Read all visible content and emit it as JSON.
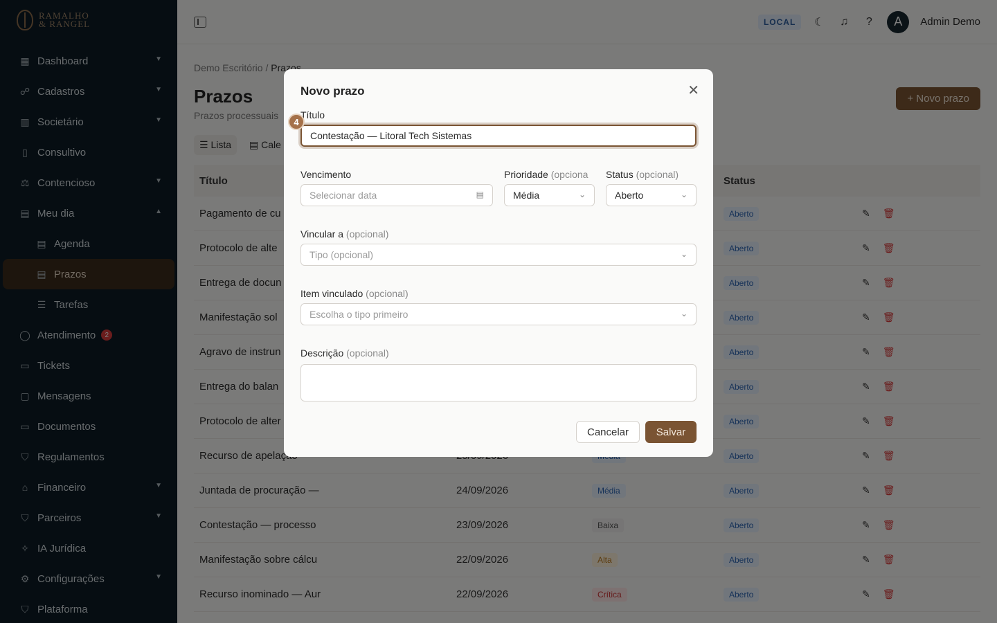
{
  "brand": {
    "name_line1": "RAMALHO",
    "name_line2": "& RANGEL"
  },
  "sidebar": {
    "items": [
      {
        "label": "Dashboard",
        "icon": "grid-icon"
      },
      {
        "label": "Cadastros",
        "icon": "people-icon"
      },
      {
        "label": "Societário",
        "icon": "building-icon"
      },
      {
        "label": "Consultivo",
        "icon": "book-icon"
      },
      {
        "label": "Contencioso",
        "icon": "scales-icon"
      },
      {
        "label": "Meu dia",
        "icon": "calendar-icon"
      },
      {
        "label": "Agenda",
        "icon": "calendar-icon"
      },
      {
        "label": "Prazos",
        "icon": "calendar-clock-icon"
      },
      {
        "label": "Tarefas",
        "icon": "checklist-icon"
      },
      {
        "label": "Atendimento",
        "icon": "chat-icon",
        "badge": "2"
      },
      {
        "label": "Tickets",
        "icon": "ticket-icon"
      },
      {
        "label": "Mensagens",
        "icon": "message-icon"
      },
      {
        "label": "Documentos",
        "icon": "folder-icon"
      },
      {
        "label": "Regulamentos",
        "icon": "shield-icon"
      },
      {
        "label": "Financeiro",
        "icon": "bank-icon"
      },
      {
        "label": "Parceiros",
        "icon": "handshake-icon"
      },
      {
        "label": "IA Jurídica",
        "icon": "sparkle-icon"
      },
      {
        "label": "Configurações",
        "icon": "gear-icon"
      },
      {
        "label": "Plataforma",
        "icon": "shield-icon"
      }
    ]
  },
  "topbar": {
    "env": "LOCAL",
    "user_initial": "A",
    "user_name": "Admin Demo"
  },
  "page": {
    "breadcrumb_root": "Demo Escritório",
    "breadcrumb_sep": "/",
    "breadcrumb_current": "Prazos",
    "title": "Prazos",
    "subtitle": "Prazos processuais",
    "new_button": "Novo prazo",
    "view_list": "Lista",
    "view_calendar": "Cale"
  },
  "table": {
    "headers": {
      "title": "Título",
      "status": "Status"
    },
    "rows": [
      {
        "title": "Pagamento de cu",
        "date": "",
        "prio": "",
        "prio_class": "",
        "status": "Aberto"
      },
      {
        "title": "Protocolo de alte",
        "date": "",
        "prio": "",
        "prio_class": "",
        "status": "Aberto"
      },
      {
        "title": "Entrega de docun",
        "date": "",
        "prio": "",
        "prio_class": "",
        "status": "Aberto"
      },
      {
        "title": "Manifestação sol",
        "date": "",
        "prio": "",
        "prio_class": "",
        "status": "Aberto"
      },
      {
        "title": "Agravo de instrun",
        "date": "",
        "prio": "",
        "prio_class": "",
        "status": "Aberto"
      },
      {
        "title": "Entrega do balan",
        "date": "",
        "prio": "",
        "prio_class": "",
        "status": "Aberto"
      },
      {
        "title": "Protocolo de alter",
        "date": "",
        "prio": "",
        "prio_class": "",
        "status": "Aberto"
      },
      {
        "title": "Recurso de apelação",
        "date": "25/09/2026",
        "prio": "Média",
        "prio_class": "p-media",
        "status": "Aberto"
      },
      {
        "title": "Juntada de procuração —",
        "date": "24/09/2026",
        "prio": "Média",
        "prio_class": "p-media",
        "status": "Aberto"
      },
      {
        "title": "Contestação — processo",
        "date": "23/09/2026",
        "prio": "Baixa",
        "prio_class": "p-baixa",
        "status": "Aberto"
      },
      {
        "title": "Manifestação sobre cálcu",
        "date": "22/09/2026",
        "prio": "Alta",
        "prio_class": "p-alta",
        "status": "Aberto"
      },
      {
        "title": "Recurso inominado — Aur",
        "date": "22/09/2026",
        "prio": "Crítica",
        "prio_class": "p-critica",
        "status": "Aberto"
      }
    ]
  },
  "modal": {
    "title": "Novo prazo",
    "marker": "4",
    "titulo_label": "Título",
    "titulo_value": "Contestação — Litoral Tech Sistemas",
    "vencimento_label": "Vencimento",
    "vencimento_placeholder": "Selecionar data",
    "prioridade_label": "Prioridade",
    "prioridade_opt": "(opciona",
    "prioridade_value": "Média",
    "status_label": "Status",
    "status_opt": "(opcional)",
    "status_value": "Aberto",
    "vincular_label": "Vincular a",
    "vincular_opt": "(opcional)",
    "vincular_placeholder": "Tipo (opcional)",
    "item_label": "Item vinculado",
    "item_opt": "(opcional)",
    "item_placeholder": "Escolha o tipo primeiro",
    "descricao_label": "Descrição",
    "descricao_opt": "(opcional)",
    "cancel": "Cancelar",
    "save": "Salvar"
  }
}
